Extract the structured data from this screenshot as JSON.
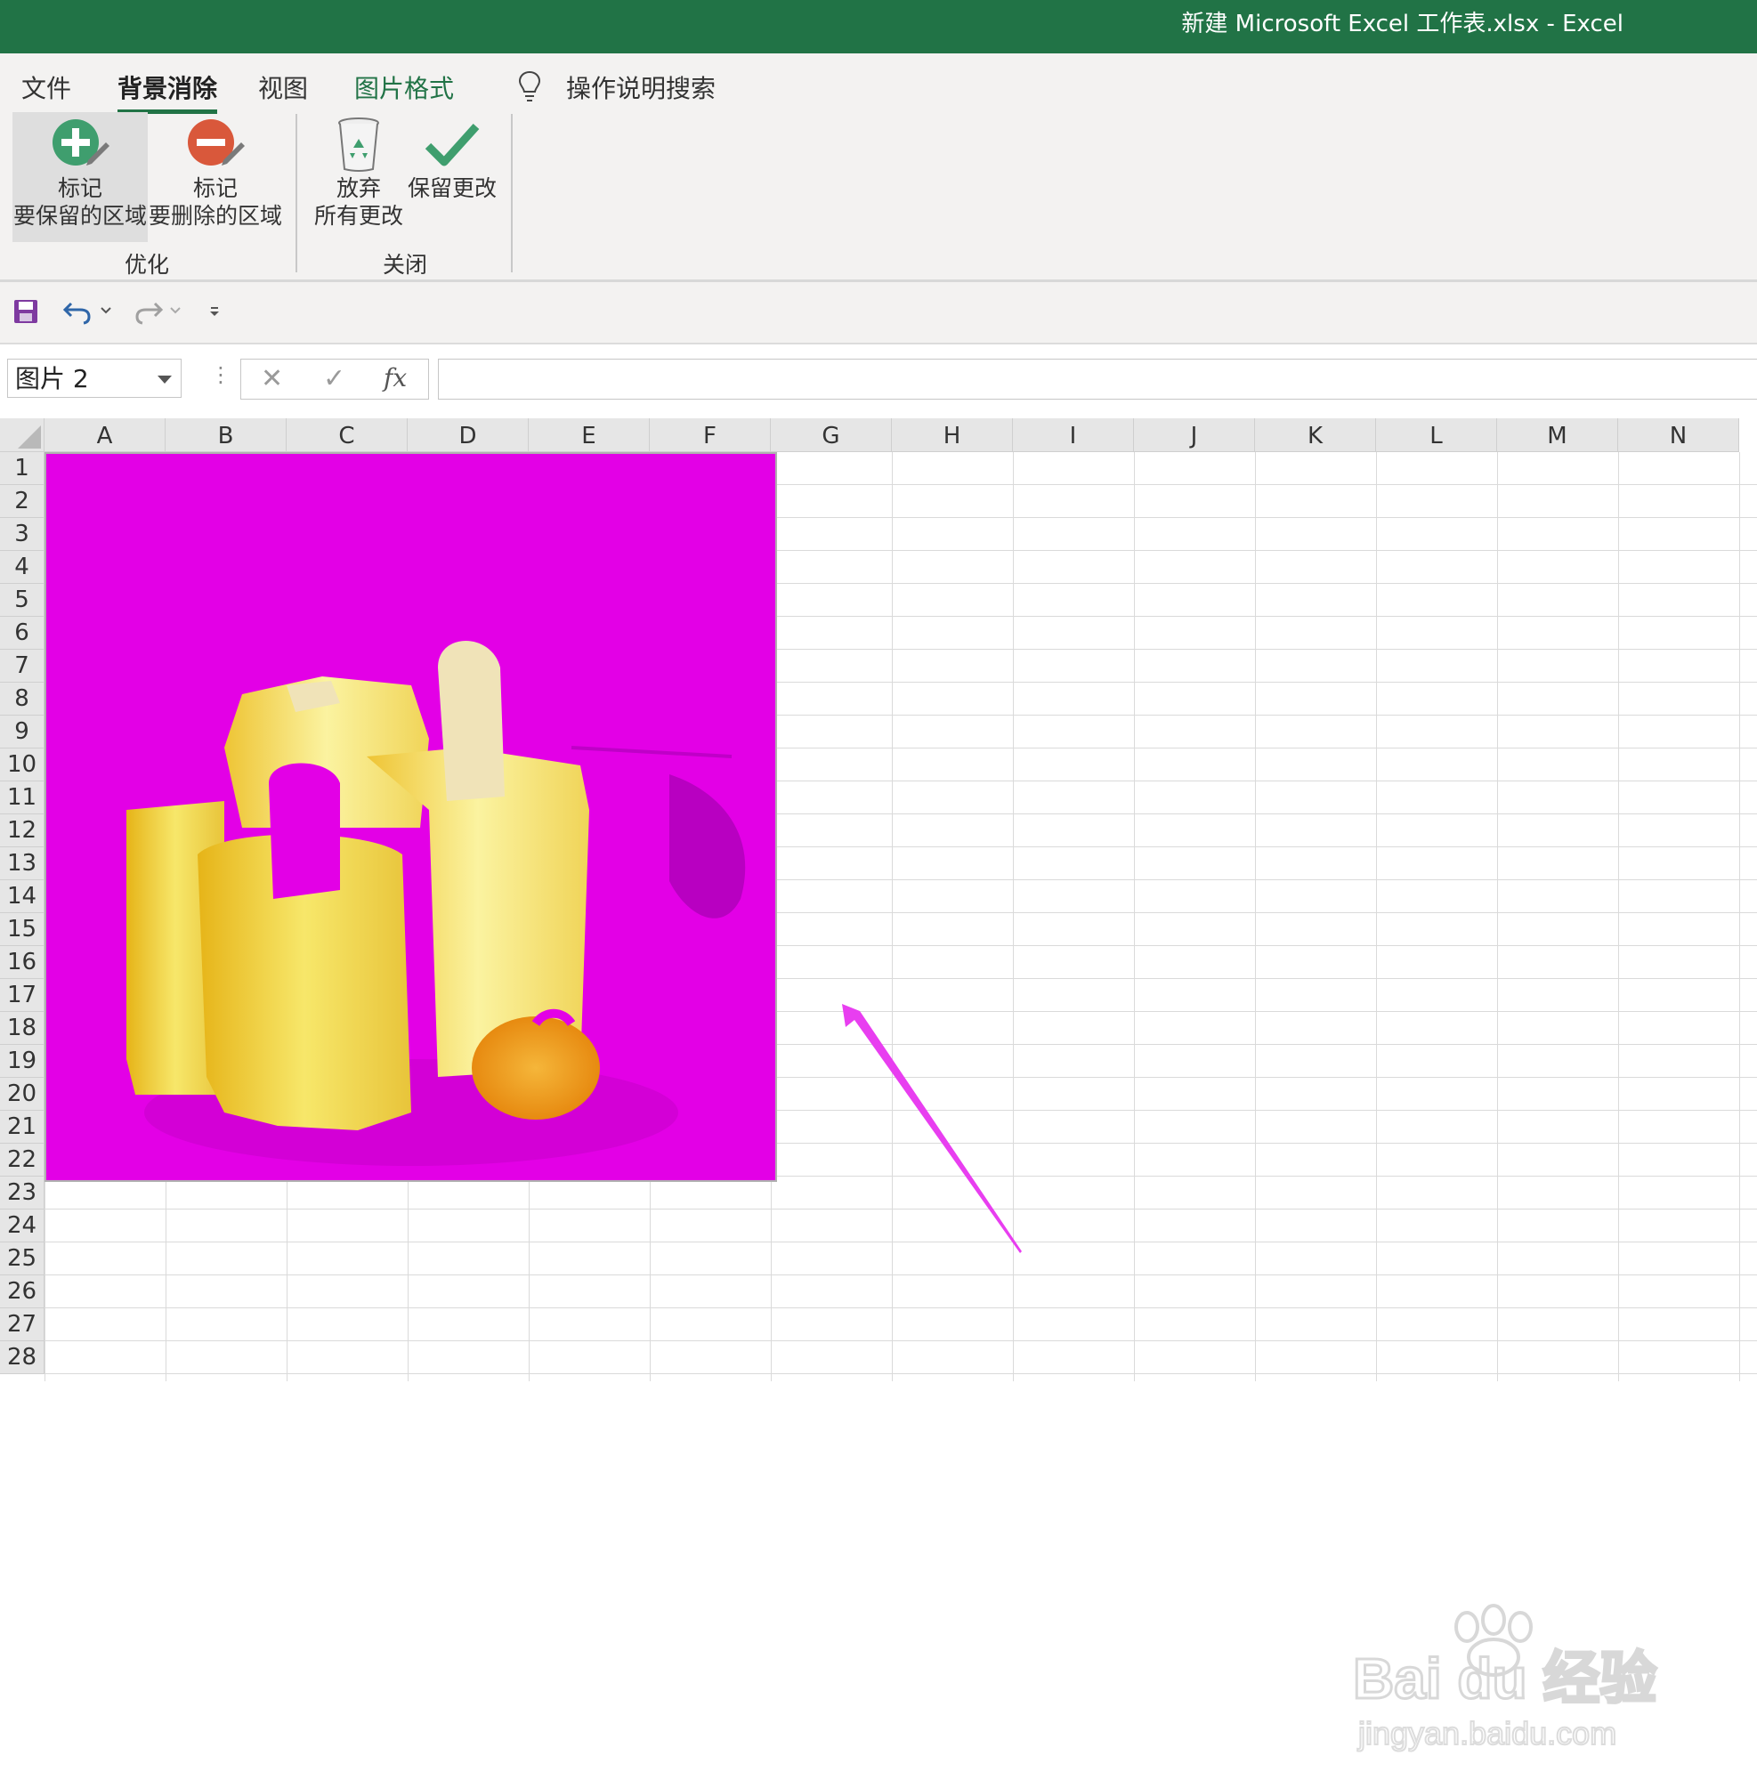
{
  "window": {
    "title": "新建 Microsoft Excel 工作表.xlsx  -  Excel"
  },
  "ribbon": {
    "tabs": [
      {
        "label": "文件"
      },
      {
        "label": "背景消除",
        "active": true
      },
      {
        "label": "视图"
      },
      {
        "label": "图片格式"
      }
    ],
    "tell_me": "操作说明搜索",
    "buttons": {
      "mark_keep": {
        "line1": "标记",
        "line2": "要保留的区域"
      },
      "mark_remove": {
        "line1": "标记",
        "line2": "要删除的区域"
      },
      "discard": {
        "line1": "放弃",
        "line2": "所有更改"
      },
      "keep_changes": {
        "line1": "保留更改"
      }
    },
    "groups": {
      "refine": "优化",
      "close": "关闭"
    }
  },
  "formula_bar": {
    "name_box": "图片 2",
    "fx": "fx",
    "value": ""
  },
  "grid": {
    "columns": [
      "A",
      "B",
      "C",
      "D",
      "E",
      "F",
      "G",
      "H",
      "I",
      "J",
      "K",
      "L",
      "M",
      "N"
    ],
    "rows": [
      "1",
      "2",
      "3",
      "4",
      "5",
      "6",
      "7",
      "8",
      "9",
      "10",
      "11",
      "12",
      "13",
      "14",
      "15",
      "16",
      "17",
      "18",
      "19",
      "20",
      "21",
      "22",
      "23",
      "24",
      "25",
      "26",
      "27",
      "28"
    ]
  },
  "colors": {
    "excel_green": "#217346",
    "removal_overlay": "#e300e6",
    "annotation_arrow": "#e83ef0"
  },
  "watermark": {
    "brand": "Bai du 经验",
    "url": "jingyan.baidu.com"
  }
}
